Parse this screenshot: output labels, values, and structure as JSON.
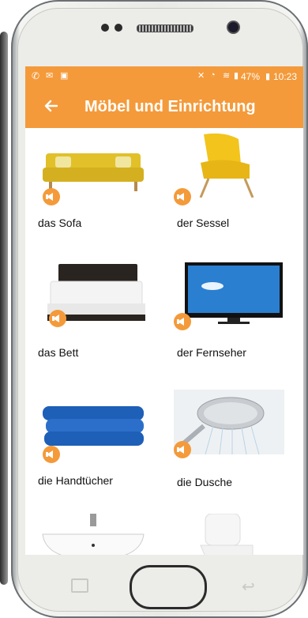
{
  "status_bar": {
    "left_icons": [
      "missed-call-icon",
      "message-icon",
      "image-icon"
    ],
    "right_icons": [
      "mute-icon",
      "alarm-icon",
      "wifi-icon",
      "signal-icon"
    ],
    "battery": "47%",
    "time": "10:23"
  },
  "app_bar": {
    "back_icon": "arrow-left-icon",
    "title": "Möbel und Einrichtung"
  },
  "items": [
    {
      "label": "das Sofa",
      "image": "sofa"
    },
    {
      "label": "der Sessel",
      "image": "armchair"
    },
    {
      "label": "das Bett",
      "image": "bed"
    },
    {
      "label": "der Fernseher",
      "image": "television"
    },
    {
      "label": "die Handtücher",
      "image": "towels"
    },
    {
      "label": "die Dusche",
      "image": "shower"
    },
    {
      "label": "",
      "image": "sink"
    },
    {
      "label": "",
      "image": "toilet"
    }
  ],
  "colors": {
    "accent": "#f49a3a",
    "text": "#111111"
  }
}
